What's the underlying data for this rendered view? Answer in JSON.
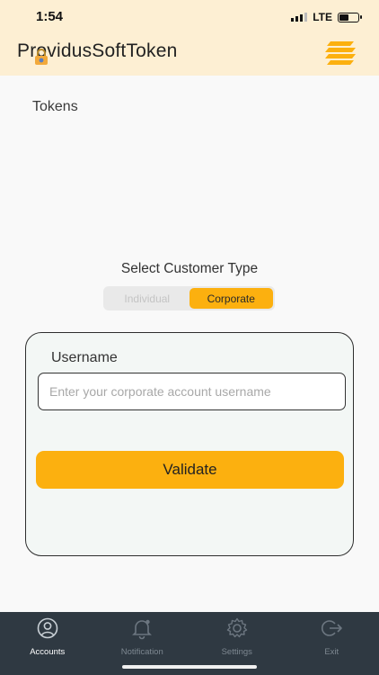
{
  "status_bar": {
    "time": "1:54",
    "network": "LTE",
    "battery_level": 0.45
  },
  "header": {
    "title": "ProvidusSoftToken",
    "icons": [
      "lock-icon",
      "menu-icon"
    ]
  },
  "tokens_label": "Tokens",
  "customer_type": {
    "heading": "Select Customer Type",
    "options": [
      "Individual",
      "Corporate"
    ],
    "selected": "Corporate"
  },
  "form": {
    "username_label": "Username",
    "username_value": "",
    "username_placeholder": "Enter your corporate account username",
    "validate_label": "Validate"
  },
  "tabbar": {
    "items": [
      {
        "label": "Accounts",
        "icon": "accounts-icon",
        "active": true
      },
      {
        "label": "Notification",
        "icon": "notification-icon",
        "active": false
      },
      {
        "label": "Settings",
        "icon": "settings-icon",
        "active": false
      },
      {
        "label": "Exit",
        "icon": "exit-icon",
        "active": false
      }
    ]
  },
  "colors": {
    "accent": "#fcb00f",
    "header_bg": "#fdefd3",
    "tabbar_bg": "#2f3942"
  }
}
